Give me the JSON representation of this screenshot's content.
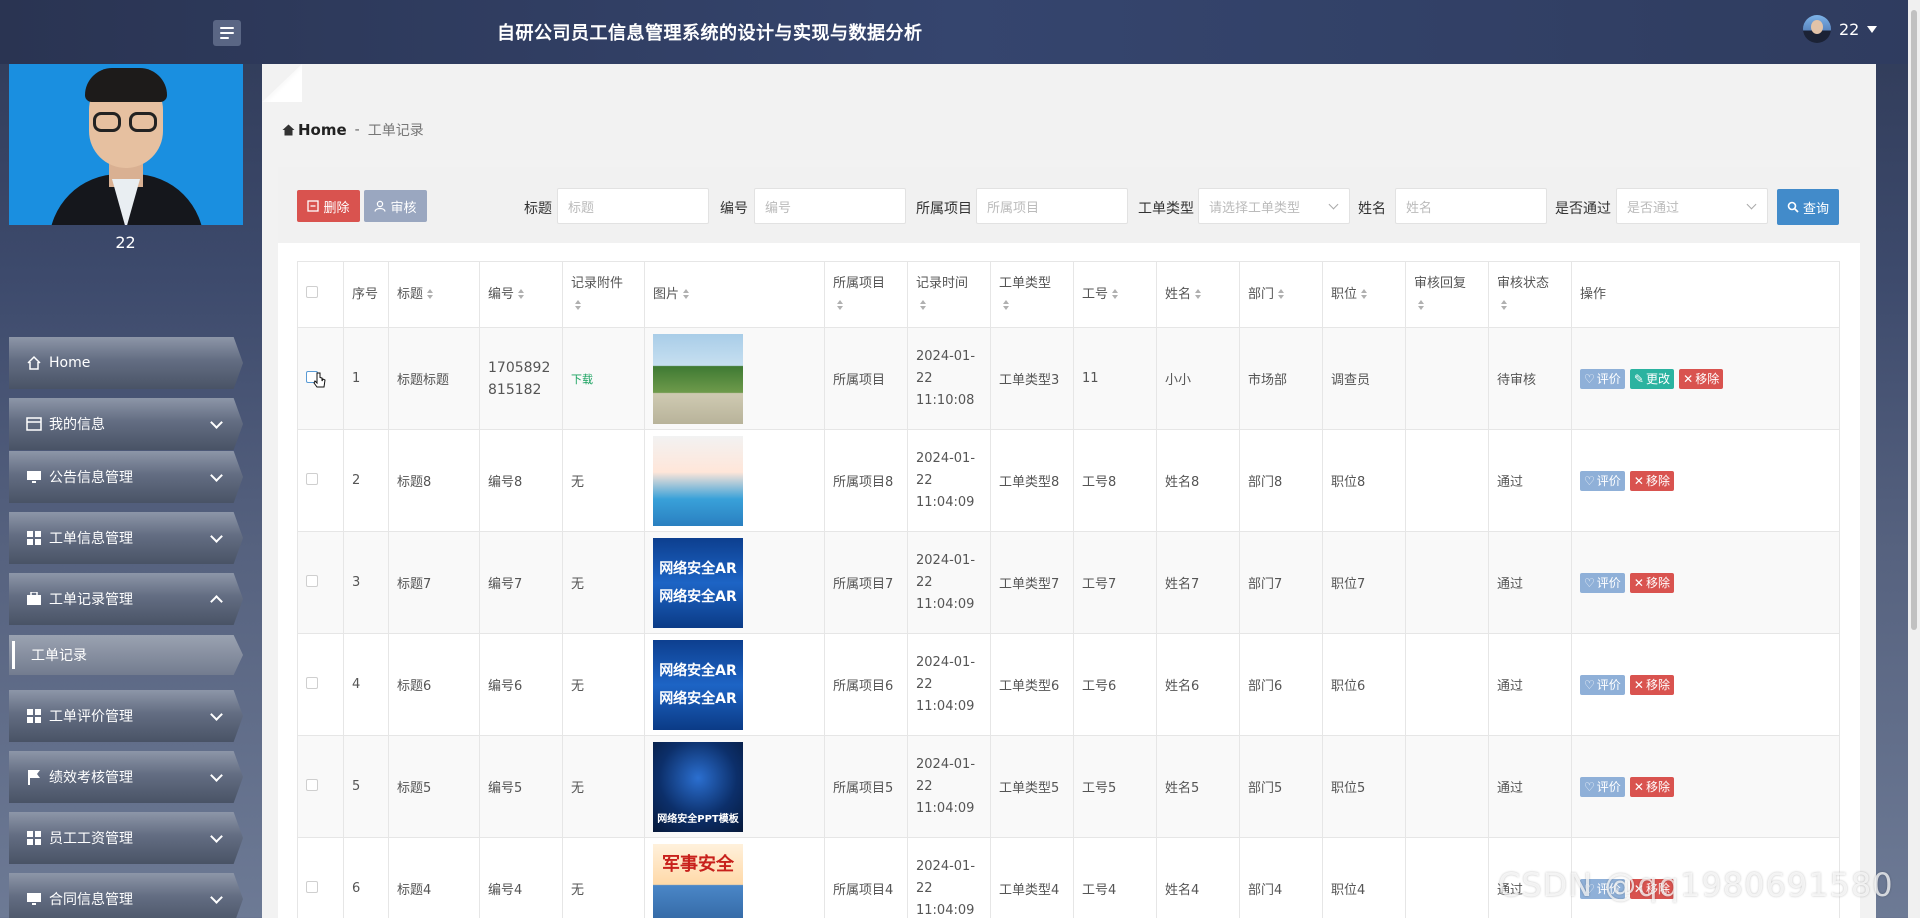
{
  "app": {
    "title": "自研公司员工信息管理系统的设计与实现与数据分析"
  },
  "user": {
    "name": "22"
  },
  "sidebar": {
    "profile_name": "22",
    "items": [
      {
        "label": "Home",
        "icon": "home-icon"
      },
      {
        "label": "我的信息",
        "icon": "card-icon"
      },
      {
        "label": "公告信息管理",
        "icon": "monitor-icon"
      },
      {
        "label": "工单信息管理",
        "icon": "grid-icon"
      },
      {
        "label": "工单记录管理",
        "icon": "briefcase-icon",
        "expanded": true
      },
      {
        "label": "工单评价管理",
        "icon": "grid-icon"
      },
      {
        "label": "绩效考核管理",
        "icon": "flag-icon"
      },
      {
        "label": "员工工资管理",
        "icon": "grid-icon"
      },
      {
        "label": "合同信息管理",
        "icon": "monitor-icon"
      }
    ],
    "sub_item": "工单记录"
  },
  "breadcrumb": {
    "home": "Home",
    "sep": "-",
    "current": "工单记录"
  },
  "toolbar": {
    "delete_label": "删除",
    "audit_label": "审核",
    "search_label": "查询"
  },
  "filters": [
    {
      "label": "标题",
      "placeholder": "标题"
    },
    {
      "label": "编号",
      "placeholder": "编号"
    },
    {
      "label": "所属项目",
      "placeholder": "所属项目"
    },
    {
      "label": "工单类型",
      "placeholder": "请选择工单类型"
    },
    {
      "label": "姓名",
      "placeholder": "姓名"
    },
    {
      "label": "是否通过",
      "placeholder": "是否通过"
    }
  ],
  "table": {
    "headers": [
      "序号",
      "标题",
      "编号",
      "记录附件",
      "图片",
      "所属项目",
      "记录时间",
      "工单类型",
      "工号",
      "姓名",
      "部门",
      "职位",
      "审核回复",
      "审核状态",
      "操作"
    ],
    "rows": [
      {
        "no": "1",
        "title": "标题标题",
        "code": "1705892815182",
        "attach": "下载",
        "project": "所属项目",
        "time": "2024-01-22 11:10:08",
        "type": "工单类型3",
        "staff_no": "11",
        "name": "小小",
        "dept": "市场部",
        "pos": "调查员",
        "reply": "",
        "status": "待审核",
        "img": "mountain road photo"
      },
      {
        "no": "2",
        "title": "标题8",
        "code": "编号8",
        "attach": "无",
        "project": "所属项目8",
        "time": "2024-01-22 11:04:09",
        "type": "工单类型8",
        "staff_no": "工号8",
        "name": "姓名8",
        "dept": "部门8",
        "pos": "职位8",
        "reply": "",
        "status": "通过",
        "img": "safety poster"
      },
      {
        "no": "3",
        "title": "标题7",
        "code": "编号7",
        "attach": "无",
        "project": "所属项目7",
        "time": "2024-01-22 11:04:09",
        "type": "工单类型7",
        "staff_no": "工号7",
        "name": "姓名7",
        "dept": "部门7",
        "pos": "职位7",
        "reply": "",
        "status": "通过",
        "img": "network security banner"
      },
      {
        "no": "4",
        "title": "标题6",
        "code": "编号6",
        "attach": "无",
        "project": "所属项目6",
        "time": "2024-01-22 11:04:09",
        "type": "工单类型6",
        "staff_no": "工号6",
        "name": "姓名6",
        "dept": "部门6",
        "pos": "职位6",
        "reply": "",
        "status": "通过",
        "img": "network security banner"
      },
      {
        "no": "5",
        "title": "标题5",
        "code": "编号5",
        "attach": "无",
        "project": "所属项目5",
        "time": "2024-01-22 11:04:09",
        "type": "工单类型5",
        "staff_no": "工号5",
        "name": "姓名5",
        "dept": "部门5",
        "pos": "职位5",
        "reply": "",
        "status": "通过",
        "img": "network security PPT template"
      },
      {
        "no": "6",
        "title": "标题4",
        "code": "编号4",
        "attach": "无",
        "project": "所属项目4",
        "time": "2024-01-22 11:04:09",
        "type": "工单类型4",
        "staff_no": "工号4",
        "name": "姓名4",
        "dept": "部门4",
        "pos": "职位4",
        "reply": "",
        "status": "通过",
        "img": "military security poster"
      }
    ],
    "image_captions": {
      "r3": "网络安全AR",
      "r5": "网络安全PPT模板",
      "r6": "军事安全"
    },
    "actions": {
      "eval": "评价",
      "edit": "更改",
      "remove": "移除"
    }
  },
  "watermark": "CSDN @qq1980691580"
}
